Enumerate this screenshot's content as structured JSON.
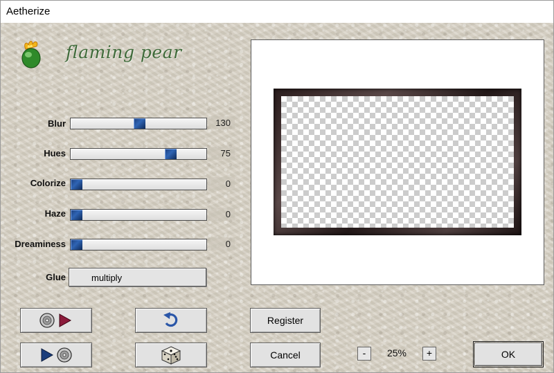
{
  "window": {
    "title": "Aetherize"
  },
  "brand": {
    "name": "flaming pear",
    "color": "#3f6b3a"
  },
  "sliders": [
    {
      "label": "Blur",
      "value": "130",
      "fraction": 0.51
    },
    {
      "label": "Hues",
      "value": "75",
      "fraction": 0.76
    },
    {
      "label": "Colorize",
      "value": "0",
      "fraction": 0.0
    },
    {
      "label": "Haze",
      "value": "0",
      "fraction": 0.0
    },
    {
      "label": "Dreaminess",
      "value": "0",
      "fraction": 0.0
    }
  ],
  "glue": {
    "label": "Glue",
    "value": "multiply"
  },
  "buttons": {
    "load_preset_icon": "disc-play-icon",
    "save_preset_icon": "play-disc-icon",
    "undo_icon": "undo-arrow-icon",
    "random_icon": "dice-icon",
    "register": "Register",
    "cancel": "Cancel",
    "ok": "OK"
  },
  "zoom": {
    "minus": "-",
    "plus": "+",
    "level": "25%"
  },
  "colors": {
    "thumb": "#2f64b4",
    "play": "#8b1a3a"
  }
}
